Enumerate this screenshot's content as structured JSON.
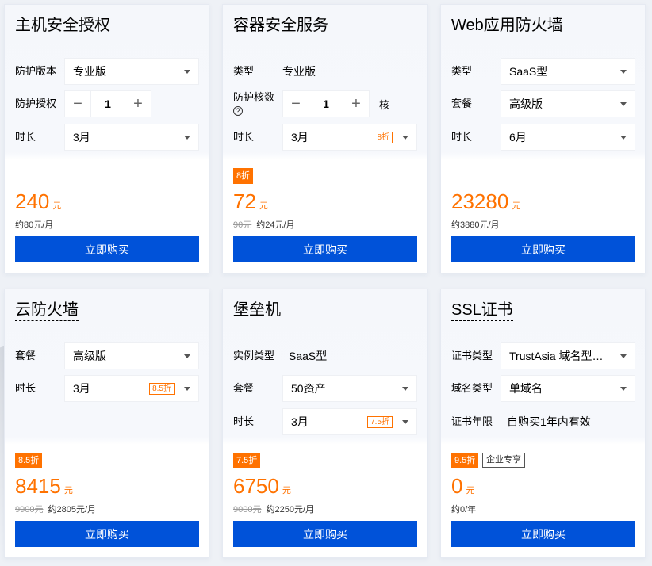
{
  "cards": [
    {
      "title": "主机安全授权",
      "rows": {
        "edition_label": "防护版本",
        "edition_value": "专业版",
        "license_label": "防护授权",
        "license_value": "1",
        "duration_label": "时长",
        "duration_value": "3月"
      },
      "price": "240",
      "currency": "元",
      "per": "约80元/月",
      "buy": "立即购买"
    },
    {
      "title": "容器安全服务",
      "rows": {
        "type_label": "类型",
        "type_value": "专业版",
        "cores_label": "防护核数",
        "cores_value": "1",
        "cores_unit": "核",
        "duration_label": "时长",
        "duration_value": "3月",
        "duration_discount": "8折"
      },
      "discount": "8折",
      "price": "72",
      "currency": "元",
      "original": "90元",
      "per": "约24元/月",
      "buy": "立即购买"
    },
    {
      "title": "Web应用防火墙",
      "rows": {
        "type_label": "类型",
        "type_value": "SaaS型",
        "plan_label": "套餐",
        "plan_value": "高级版",
        "duration_label": "时长",
        "duration_value": "6月"
      },
      "price": "23280",
      "currency": "元",
      "per": "约3880元/月",
      "buy": "立即购买"
    },
    {
      "title": "云防火墙",
      "rows": {
        "plan_label": "套餐",
        "plan_value": "高级版",
        "duration_label": "时长",
        "duration_value": "3月",
        "duration_discount": "8.5折"
      },
      "discount": "8.5折",
      "price": "8415",
      "currency": "元",
      "original": "9900元",
      "per": "约2805元/月",
      "buy": "立即购买"
    },
    {
      "title": "堡垒机",
      "rows": {
        "instance_label": "实例类型",
        "instance_value": "SaaS型",
        "plan_label": "套餐",
        "plan_value": "50资产",
        "duration_label": "时长",
        "duration_value": "3月",
        "duration_discount": "7.5折"
      },
      "discount": "7.5折",
      "price": "6750",
      "currency": "元",
      "original": "9000元",
      "per": "约2250元/月",
      "buy": "立即购买"
    },
    {
      "title": "SSL证书",
      "rows": {
        "cert_type_label": "证书类型",
        "cert_type_value": "TrustAsia 域名型…",
        "domain_type_label": "域名类型",
        "domain_type_value": "单域名",
        "years_label": "证书年限",
        "years_value": "自购买1年内有效"
      },
      "discount": "9.5折",
      "enterprise": "企业专享",
      "price": "0",
      "currency": "元",
      "per": "约0/年",
      "buy": "立即购买"
    }
  ],
  "colors": {
    "accent": "#0052d9",
    "price": "#ff7200"
  }
}
